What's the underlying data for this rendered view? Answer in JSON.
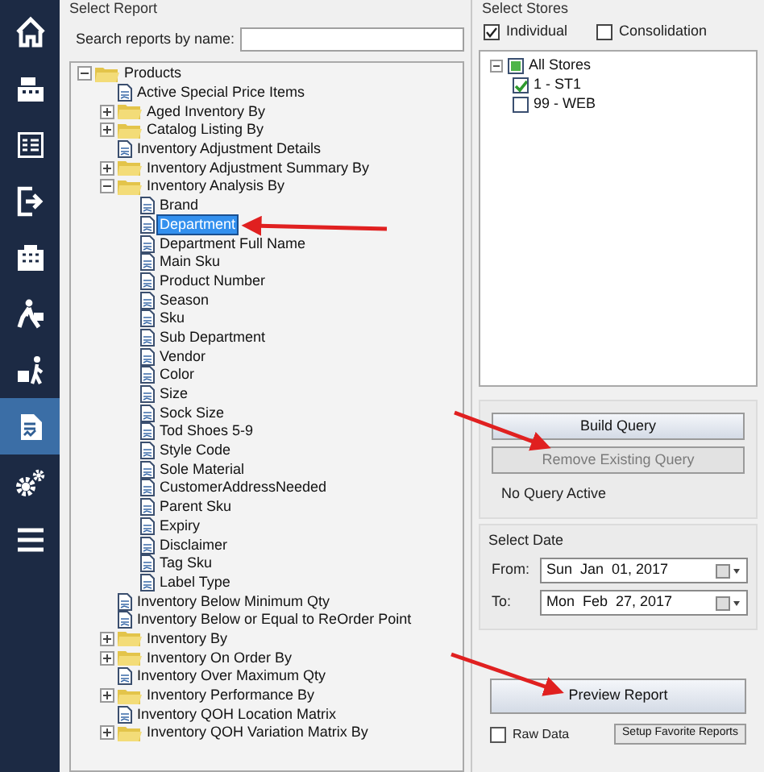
{
  "sidebar": {
    "items": [
      {
        "selected": false
      },
      {
        "selected": false
      },
      {
        "selected": false
      },
      {
        "selected": false
      },
      {
        "selected": false
      },
      {
        "selected": false
      },
      {
        "selected": false
      },
      {
        "selected": true
      },
      {
        "selected": false
      },
      {
        "selected": false
      }
    ]
  },
  "report_group": {
    "title": "Select Report",
    "search_label": "Search reports by name:",
    "tree": [
      {
        "kind": "folder",
        "label": "Products",
        "expanded": true,
        "selected": false,
        "children": [
          {
            "kind": "report",
            "label": "Active Special Price Items",
            "selected": false
          },
          {
            "kind": "folder",
            "label": "Aged Inventory By",
            "expanded": false,
            "selected": false
          },
          {
            "kind": "folder",
            "label": "Catalog Listing By",
            "expanded": false,
            "selected": false
          },
          {
            "kind": "report",
            "label": "Inventory Adjustment Details",
            "selected": false
          },
          {
            "kind": "folder",
            "label": "Inventory Adjustment Summary By",
            "expanded": false,
            "selected": false
          },
          {
            "kind": "folder",
            "label": "Inventory Analysis By",
            "expanded": true,
            "selected": false,
            "children": [
              {
                "kind": "report",
                "label": "Brand",
                "selected": false
              },
              {
                "kind": "report",
                "label": "Department",
                "selected": true
              },
              {
                "kind": "report",
                "label": "Department Full Name",
                "selected": false
              },
              {
                "kind": "report",
                "label": "Main Sku",
                "selected": false
              },
              {
                "kind": "report",
                "label": "Product Number",
                "selected": false
              },
              {
                "kind": "report",
                "label": "Season",
                "selected": false
              },
              {
                "kind": "report",
                "label": "Sku",
                "selected": false
              },
              {
                "kind": "report",
                "label": "Sub Department",
                "selected": false
              },
              {
                "kind": "report",
                "label": "Vendor",
                "selected": false
              },
              {
                "kind": "report",
                "label": "Color",
                "selected": false
              },
              {
                "kind": "report",
                "label": "Size",
                "selected": false
              },
              {
                "kind": "report",
                "label": "Sock Size",
                "selected": false
              },
              {
                "kind": "report",
                "label": "Tod Shoes 5-9",
                "selected": false
              },
              {
                "kind": "report",
                "label": "Style Code",
                "selected": false
              },
              {
                "kind": "report",
                "label": "Sole Material",
                "selected": false
              },
              {
                "kind": "report",
                "label": "CustomerAddressNeeded",
                "selected": false
              },
              {
                "kind": "report",
                "label": "Parent Sku",
                "selected": false
              },
              {
                "kind": "report",
                "label": "Expiry",
                "selected": false
              },
              {
                "kind": "report",
                "label": "Disclaimer",
                "selected": false
              },
              {
                "kind": "report",
                "label": "Tag Sku",
                "selected": false
              },
              {
                "kind": "report",
                "label": "Label Type",
                "selected": false
              }
            ]
          },
          {
            "kind": "report",
            "label": "Inventory Below Minimum Qty",
            "selected": false
          },
          {
            "kind": "report",
            "label": "Inventory Below or Equal to ReOrder Point",
            "selected": false
          },
          {
            "kind": "folder",
            "label": "Inventory By",
            "expanded": false,
            "selected": false
          },
          {
            "kind": "folder",
            "label": "Inventory On Order By",
            "expanded": false,
            "selected": false
          },
          {
            "kind": "report",
            "label": "Inventory Over Maximum Qty",
            "selected": false
          },
          {
            "kind": "folder",
            "label": "Inventory Performance By",
            "expanded": false,
            "selected": false
          },
          {
            "kind": "report",
            "label": "Inventory QOH Location Matrix",
            "selected": false
          },
          {
            "kind": "folder",
            "label": "Inventory QOH Variation Matrix By",
            "expanded": false,
            "selected": false
          }
        ]
      }
    ]
  },
  "stores_group": {
    "title": "Select Stores",
    "modes": [
      {
        "label": "Individual",
        "checked": true
      },
      {
        "label": "Consolidation",
        "checked": false
      }
    ],
    "tree": [
      {
        "label": "All Stores",
        "partial": true,
        "expanded": true,
        "children": [
          {
            "label": "1 - ST1",
            "checked": true
          },
          {
            "label": "99 - WEB",
            "checked": false
          }
        ]
      }
    ]
  },
  "query": {
    "buttons": [
      {
        "label": "Build Query",
        "disabled": false
      },
      {
        "label": "Remove Existing Query",
        "disabled": true
      }
    ],
    "status": "No Query Active"
  },
  "date_group": {
    "title": "Select Date",
    "fields": [
      {
        "label": "From:",
        "value": "Sun  Jan  01, 2017"
      },
      {
        "label": "To:",
        "value": "Mon  Feb  27, 2017"
      }
    ]
  },
  "preview_button": {
    "label": "Preview Report"
  },
  "raw_data": {
    "label": "Raw Data",
    "checked": false
  },
  "favorites_button": {
    "label": "Setup Favorite Reports"
  }
}
